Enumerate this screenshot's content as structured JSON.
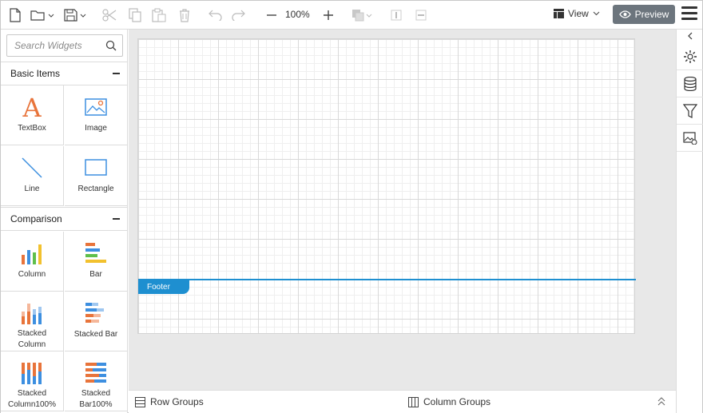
{
  "toolbar": {
    "icons": [
      "new-file-icon",
      "open-folder-icon",
      "save-icon",
      "cut-icon",
      "copy-icon",
      "paste-icon",
      "delete-icon",
      "undo-icon",
      "redo-icon",
      "zoom-out-icon",
      "zoom-in-icon",
      "bring-forward-icon",
      "align-top-icon",
      "align-middle-icon"
    ],
    "zoom_value": "100%",
    "view_label": "View",
    "preview_label": "Preview"
  },
  "search": {
    "placeholder": "Search Widgets"
  },
  "sections": {
    "basic": {
      "title": "Basic Items",
      "items": [
        {
          "label": "TextBox"
        },
        {
          "label": "Image"
        },
        {
          "label": "Line"
        },
        {
          "label": "Rectangle"
        }
      ]
    },
    "comparison": {
      "title": "Comparison",
      "items": [
        {
          "label": "Column"
        },
        {
          "label": "Bar"
        },
        {
          "label": "Stacked\nColumn"
        },
        {
          "label": "Stacked Bar"
        },
        {
          "label": "Stacked\nColumn100%"
        },
        {
          "label": "Stacked\nBar100%"
        }
      ]
    }
  },
  "canvas": {
    "footer_label": "Footer"
  },
  "bottom": {
    "row_groups": "Row Groups",
    "column_groups": "Column Groups"
  },
  "rail": {
    "icons": [
      "collapse-left-icon",
      "settings-icon",
      "database-icon",
      "filter-icon",
      "image-settings-icon"
    ]
  },
  "colors": {
    "accent": "#1e8fd0",
    "preview_bg": "#6c757d",
    "icon_blue": "#3d8fe0",
    "textbox_orange": "#e8743b"
  }
}
